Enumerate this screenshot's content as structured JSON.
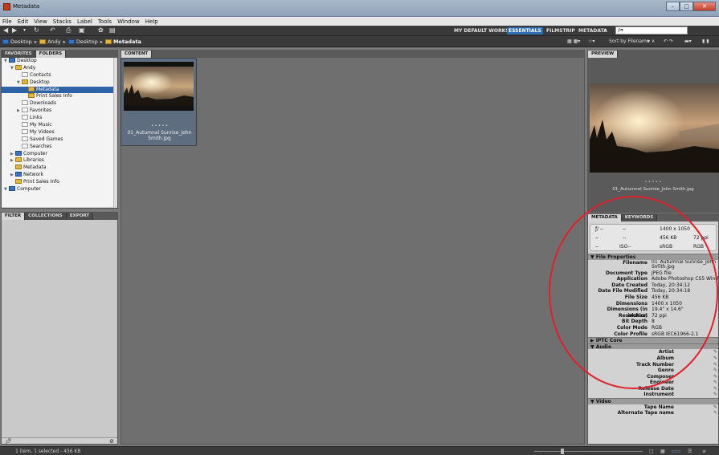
{
  "window": {
    "title": "Metadata"
  },
  "menu": [
    "File",
    "Edit",
    "View",
    "Stacks",
    "Label",
    "Tools",
    "Window",
    "Help"
  ],
  "workspaces": {
    "default": "MY DEFAULT WORKSPACE",
    "essentials": "ESSENTIALS",
    "filmstrip": "FILMSTRIP",
    "metadata": "METADATA"
  },
  "search": {
    "placeholder": "ρ▾"
  },
  "breadcrumb": {
    "items": [
      "Desktop",
      "Andy",
      "Desktop"
    ],
    "current": "Metadata"
  },
  "sort_label": "Sort by Filename",
  "panels": {
    "folders_tabs": [
      "FAVORITES",
      "FOLDERS"
    ],
    "content_tab": "CONTENT",
    "filter_tabs": [
      "FILTER",
      "COLLECTIONS",
      "EXPORT"
    ],
    "preview_tab": "PREVIEW",
    "meta_tabs": [
      "METADATA",
      "KEYWORDS"
    ]
  },
  "folders": [
    {
      "label": "Desktop",
      "level": 0,
      "twisty": "▼",
      "type": "blue"
    },
    {
      "label": "Andy",
      "level": 1,
      "twisty": "▼",
      "type": "folder"
    },
    {
      "label": "Contacts",
      "level": 2,
      "twisty": "",
      "type": "plain"
    },
    {
      "label": "Desktop",
      "level": 2,
      "twisty": "▼",
      "type": "folder"
    },
    {
      "label": "Metadata",
      "level": 3,
      "twisty": "",
      "type": "folder",
      "selected": true
    },
    {
      "label": "Print Sales Info",
      "level": 3,
      "twisty": "",
      "type": "folder"
    },
    {
      "label": "Downloads",
      "level": 2,
      "twisty": "",
      "type": "plain"
    },
    {
      "label": "Favorites",
      "level": 2,
      "twisty": "▶",
      "type": "plain"
    },
    {
      "label": "Links",
      "level": 2,
      "twisty": "",
      "type": "plain"
    },
    {
      "label": "My Music",
      "level": 2,
      "twisty": "",
      "type": "plain"
    },
    {
      "label": "My Videos",
      "level": 2,
      "twisty": "",
      "type": "plain"
    },
    {
      "label": "Saved Games",
      "level": 2,
      "twisty": "",
      "type": "plain"
    },
    {
      "label": "Searches",
      "level": 2,
      "twisty": "",
      "type": "plain"
    },
    {
      "label": "Computer",
      "level": 1,
      "twisty": "▶",
      "type": "blue"
    },
    {
      "label": "Libraries",
      "level": 1,
      "twisty": "▶",
      "type": "folder"
    },
    {
      "label": "Metadata",
      "level": 1,
      "twisty": "",
      "type": "folder"
    },
    {
      "label": "Network",
      "level": 1,
      "twisty": "▶",
      "type": "blue"
    },
    {
      "label": "Print Sales Info",
      "level": 1,
      "twisty": "",
      "type": "folder"
    },
    {
      "label": "Computer",
      "level": 0,
      "twisty": "▼",
      "type": "blue"
    }
  ],
  "thumbnail": {
    "dots": "• • • • •",
    "name": "01_Autumnal Sunrise_John Smith.jpg"
  },
  "preview": {
    "caption": "01_Autumnal Sunrise_John Smith.jpg",
    "dots": "• • • • •"
  },
  "quick": {
    "aperture": "ƒ/ --",
    "a2": "--",
    "b1": "--",
    "b2": "--",
    "c1": "--",
    "iso": "ISO--",
    "dims": "1400 x 1050",
    "size": "456 KB",
    "res": "72 ppi",
    "cs": "sRGB",
    "mode": "RGB"
  },
  "file_properties": {
    "title": "File Properties",
    "rows": [
      {
        "k": "Filename",
        "v": "01_Autumnal Sunrise_John Smith.jpg"
      },
      {
        "k": "Document Type",
        "v": "JPEG file"
      },
      {
        "k": "Application",
        "v": "Adobe Photoshop CS5 Windows"
      },
      {
        "k": "Date Created",
        "v": "Today, 20:34:12"
      },
      {
        "k": "Date File Modified",
        "v": "Today, 20:34:18"
      },
      {
        "k": "File Size",
        "v": "456 KB"
      },
      {
        "k": "Dimensions",
        "v": "1400 x 1050"
      },
      {
        "k": "Dimensions (in inches)",
        "v": "19.4\" x 14.6\""
      },
      {
        "k": "Resolution",
        "v": "72 ppi"
      },
      {
        "k": "Bit Depth",
        "v": "8"
      },
      {
        "k": "Color Mode",
        "v": "RGB"
      },
      {
        "k": "Color Profile",
        "v": "sRGB IEC61966-2.1"
      }
    ]
  },
  "iptc": {
    "title": "IPTC Core"
  },
  "audio": {
    "title": "Audio",
    "rows": [
      "Artist",
      "Album",
      "Track Number",
      "Genre",
      "Composer",
      "Engineer",
      "Release Date",
      "Instrument"
    ]
  },
  "video": {
    "title": "Video",
    "rows": [
      "Tape Name",
      "Alternate Tape name"
    ]
  },
  "status": "1 item, 1 selected - 456 KB",
  "colors": {
    "accent": "#2e6fb3",
    "selection": "#2e62a8",
    "annotation": "#e2202b"
  }
}
